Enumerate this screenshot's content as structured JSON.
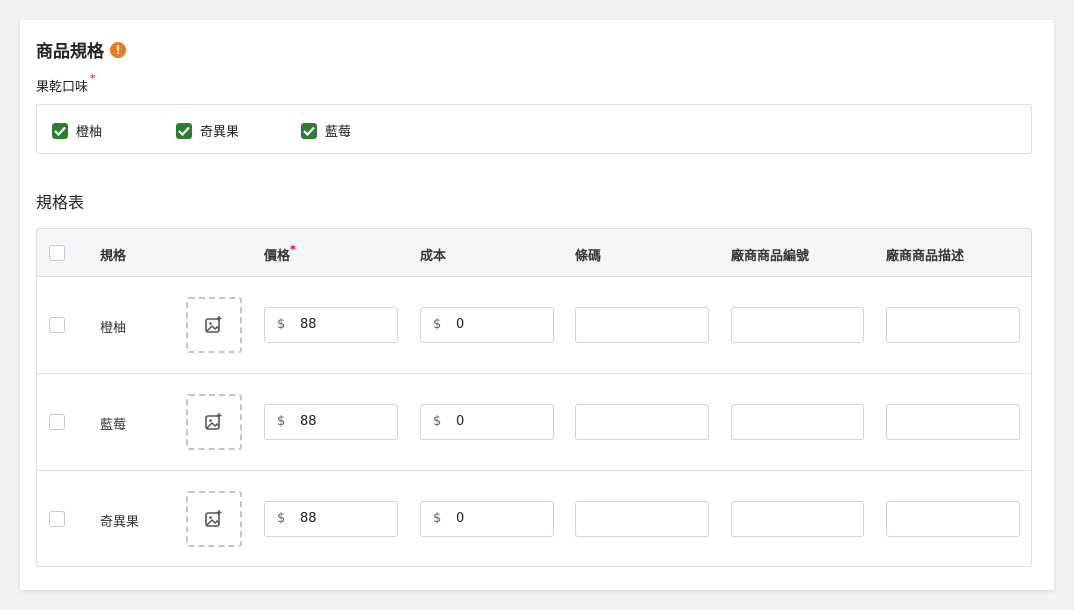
{
  "section": {
    "title": "商品規格",
    "warning_icon": "exclamation-icon"
  },
  "flavor": {
    "label": "果乾口味",
    "required_mark": "*",
    "options": [
      {
        "label": "橙柚",
        "checked": true
      },
      {
        "label": "奇異果",
        "checked": true
      },
      {
        "label": "藍莓",
        "checked": true
      }
    ]
  },
  "spec_table": {
    "title": "規格表",
    "headers": {
      "spec": "規格",
      "price": "價格",
      "price_required": "*",
      "cost": "成本",
      "barcode": "條碼",
      "vendor_sku": "廠商商品編號",
      "vendor_desc": "廠商商品描述"
    },
    "currency_symbol": "$",
    "rows": [
      {
        "name": "橙柚",
        "price": "88",
        "cost": "0",
        "barcode": "",
        "vendor_sku": "",
        "vendor_desc": ""
      },
      {
        "name": "藍莓",
        "price": "88",
        "cost": "0",
        "barcode": "",
        "vendor_sku": "",
        "vendor_desc": ""
      },
      {
        "name": "奇異果",
        "price": "88",
        "cost": "0",
        "barcode": "",
        "vendor_sku": "",
        "vendor_desc": ""
      }
    ]
  },
  "colors": {
    "accent_green": "#2e7d32",
    "warning_orange": "#f07a13",
    "required_red": "#d0021b"
  }
}
